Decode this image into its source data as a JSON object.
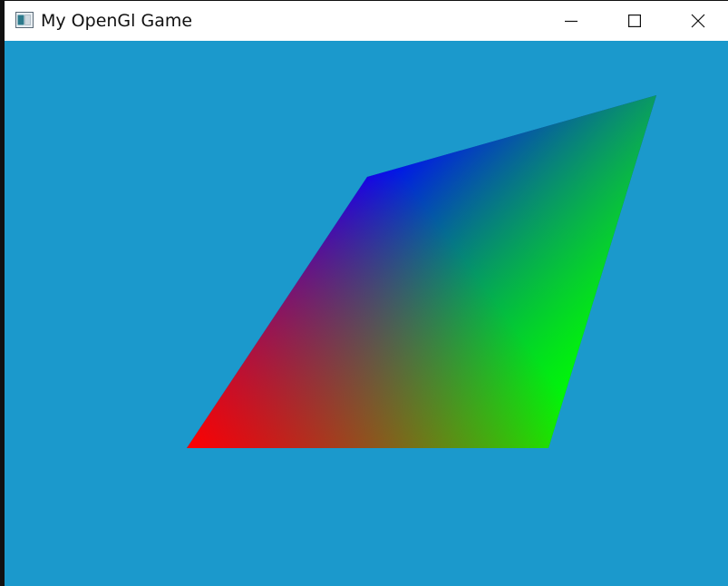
{
  "window": {
    "title": "My OpenGl Game",
    "background_color": "#1b99cc",
    "controls": [
      "minimize",
      "maximize",
      "close"
    ]
  },
  "scene": {
    "shape": "quad",
    "vertex_colors": {
      "bottom_left": "#ff0000",
      "bottom_right": "#00ff00",
      "top_left": "#0000ff",
      "top_right": "#3a5a9a"
    }
  },
  "icons": {
    "app": "app-icon",
    "minimize": "minimize-icon",
    "maximize": "maximize-icon",
    "close": "close-icon"
  }
}
